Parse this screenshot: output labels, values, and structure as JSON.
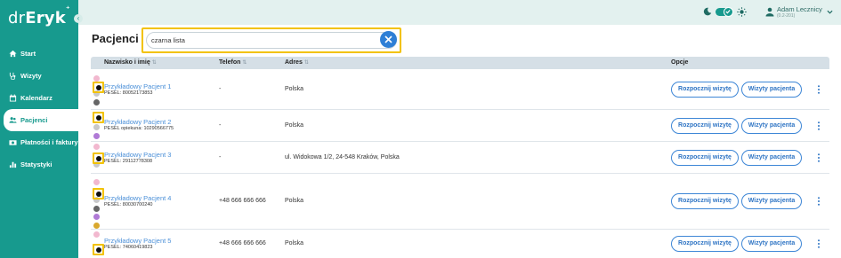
{
  "app": {
    "logo_thin": "dr",
    "logo_bold": "Eryk",
    "logo_sup": "⁺"
  },
  "sidebar": {
    "items": [
      {
        "label": "Start",
        "icon": "home-icon"
      },
      {
        "label": "Wizyty",
        "icon": "stethoscope-icon"
      },
      {
        "label": "Kalendarz",
        "icon": "calendar-icon"
      },
      {
        "label": "Pacjenci",
        "icon": "patients-icon",
        "active": true
      },
      {
        "label": "Płatności i faktury",
        "icon": "wallet-icon"
      },
      {
        "label": "Statystyki",
        "icon": "bar-chart-icon"
      }
    ]
  },
  "topbar": {
    "user_name": "Adam Lecznicy",
    "user_role": "(0.2-201)",
    "theme": "dark-mode-toggle"
  },
  "header": {
    "title": "Pacjenci",
    "search_value": "czarna lista"
  },
  "table": {
    "columns": [
      "Nazwisko i imię",
      "Telefon",
      "Adres",
      "Opcje"
    ],
    "rows": [
      {
        "name": "Przykładowy Pacjent 1",
        "pesel": "PESEL: 80052173853",
        "phone": "-",
        "address": "Polska",
        "start": "Rozpocznij wizytę",
        "visits": "Wizyty pacjenta"
      },
      {
        "name": "Przykładowy Pacjent 2",
        "pesel": "PESEL opiekuna: 10290566775",
        "phone": "-",
        "address": "Polska",
        "start": "Rozpocznij wizytę",
        "visits": "Wizyty pacjenta"
      },
      {
        "name": "Przykładowy Pacjent 3",
        "pesel": "PESEL: 29112778308",
        "phone": "-",
        "address": "ul. Widokowa 1/2, 24-548 Kraków, Polska",
        "start": "Rozpocznij wizytę",
        "visits": "Wizyty pacjenta"
      },
      {
        "name": "Przykładowy Pacjent 4",
        "pesel": "PESEL: 80030700240",
        "phone": "+48 666 666 666",
        "address": "Polska",
        "start": "Rozpocznij wizytę",
        "visits": "Wizyty pacjenta"
      },
      {
        "name": "Przykładowy Pacjent 5",
        "pesel": "PESEL: 74060419823",
        "phone": "+48 666 666 666",
        "address": "Polska",
        "start": "Rozpocznij wizytę",
        "visits": "Wizyty pacjenta"
      }
    ]
  },
  "colors": {
    "accent": "#179a8e",
    "highlight": "#f2c200",
    "link": "#4a8fd8",
    "tag_pink": "#f2b8cf",
    "tag_gray": "#c9c9c9",
    "tag_darkgray": "#666666",
    "tag_purple": "#b07ad6",
    "tag_gold": "#d9a82e",
    "tag_black": "#111111"
  }
}
